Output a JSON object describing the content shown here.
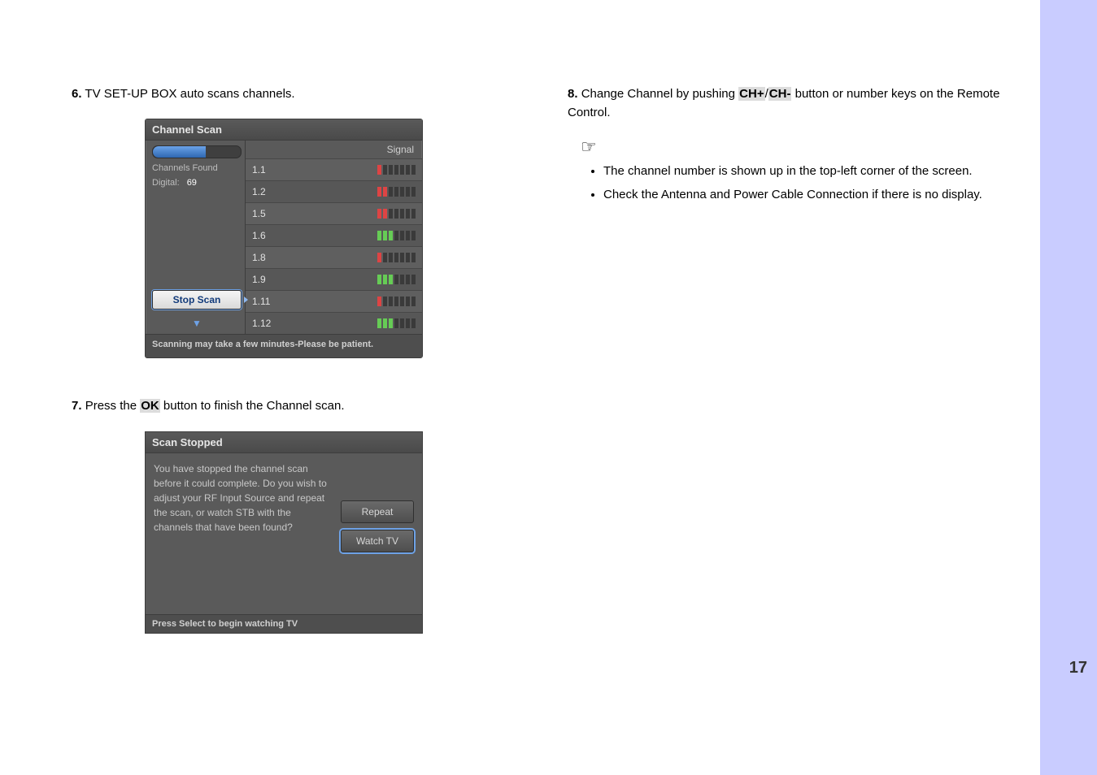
{
  "page_number": "17",
  "left_col": {
    "step6": {
      "num": "6.",
      "text": "TV SET-UP BOX  auto scans channels."
    },
    "step7": {
      "num": "7.",
      "pre": "Press the ",
      "key": "OK",
      "post": " button to finish the Channel scan."
    }
  },
  "right_col": {
    "step8": {
      "num": "8.",
      "pre": "Change Channel by pushing ",
      "key1": "CH+",
      "sep": "/",
      "key2": "CH-",
      "post": " button or number keys on the Remote Control."
    },
    "notes": [
      "The channel number is shown up in the top-left corner of the screen.",
      "Check the Antenna and Power Cable Connection if there is no display."
    ]
  },
  "channel_scan": {
    "title": "Channel Scan",
    "signal_header": "Signal",
    "channels_found_label": "Channels Found",
    "digital_label": "Digital:",
    "digital_count": "69",
    "stop_btn": "Stop Scan",
    "footer": "Scanning may take a few minutes-Please be patient.",
    "rows": [
      {
        "ch": "1.1",
        "lit": 1,
        "color": "r"
      },
      {
        "ch": "1.2",
        "lit": 2,
        "color": "r"
      },
      {
        "ch": "1.5",
        "lit": 2,
        "color": "r"
      },
      {
        "ch": "1.6",
        "lit": 3,
        "color": "g"
      },
      {
        "ch": "1.8",
        "lit": 1,
        "color": "r"
      },
      {
        "ch": "1.9",
        "lit": 3,
        "color": "g"
      },
      {
        "ch": "1.11",
        "lit": 1,
        "color": "r"
      },
      {
        "ch": "1.12",
        "lit": 3,
        "color": "g"
      }
    ]
  },
  "scan_stopped": {
    "title": "Scan Stopped",
    "message": "You have stopped the channel scan before it could complete. Do you wish to adjust your RF Input Source and repeat the scan, or watch STB with the channels that have been found?",
    "btn_repeat": "Repeat",
    "btn_watch": "Watch TV",
    "footer": "Press Select to begin watching TV"
  }
}
